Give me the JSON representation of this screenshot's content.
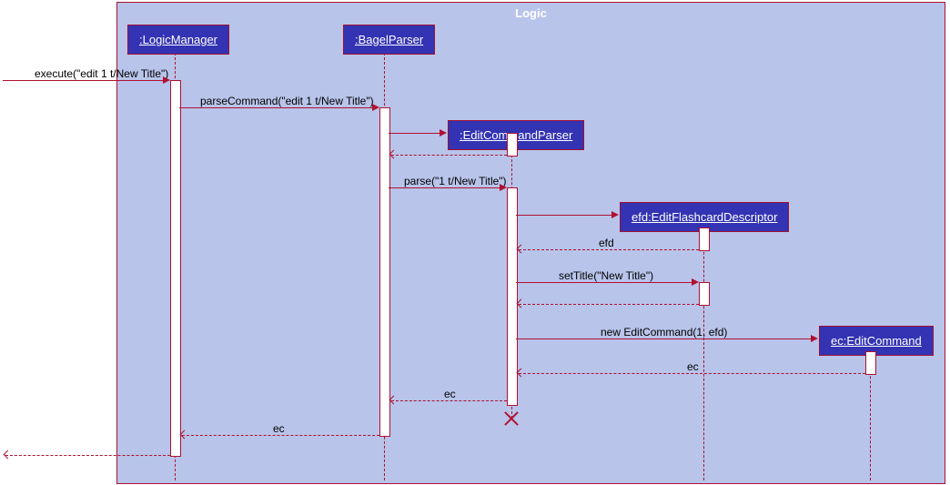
{
  "frame": {
    "title": "Logic"
  },
  "participants": {
    "p1": ":LogicManager",
    "p2": ":BagelParser",
    "p3": ":EditCommandParser",
    "p4": "efd:EditFlashcardDescriptor",
    "p5": "ec:EditCommand"
  },
  "messages": {
    "m1": "execute(\"edit 1 t/New Title\")",
    "m2": "parseCommand(\"edit 1 t/New Title\")",
    "m3": "parse(\"1 t/New Title\")",
    "m4": "efd",
    "m5": "setTitle(\"New Title\")",
    "m6": "new EditCommand(1, efd)",
    "m7": "ec",
    "m8": "ec",
    "m9": "ec"
  }
}
